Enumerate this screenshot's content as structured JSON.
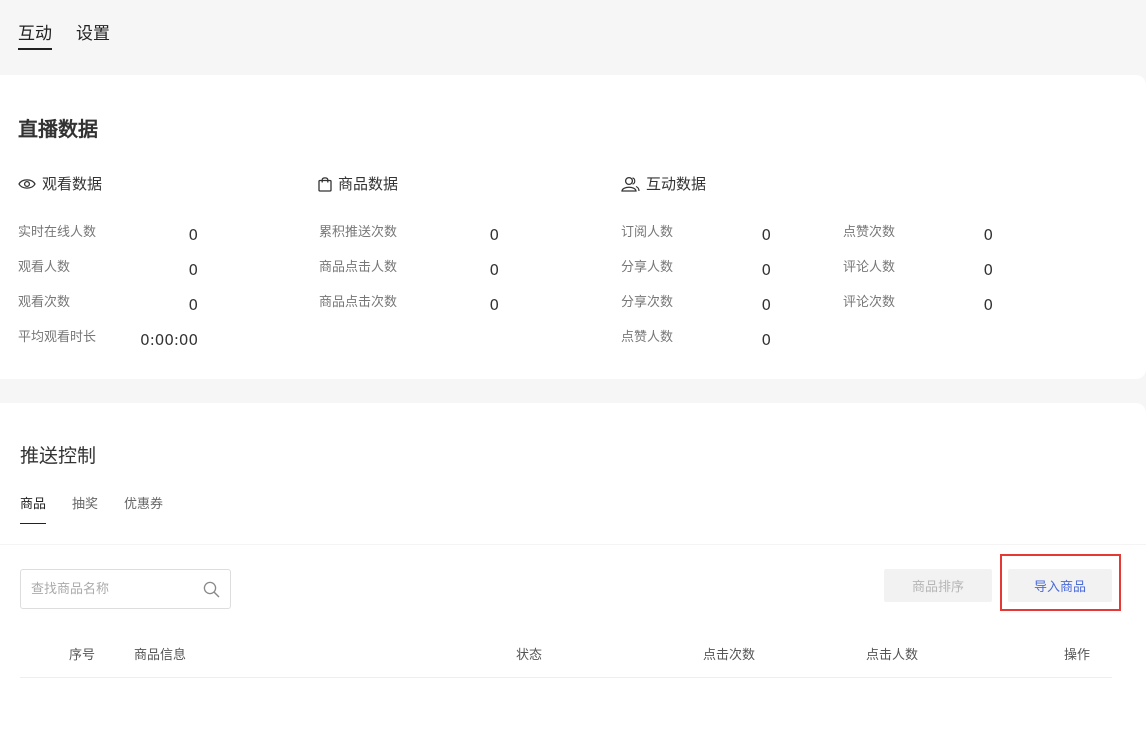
{
  "top_tabs": [
    {
      "label": "互动",
      "active": true
    },
    {
      "label": "设置",
      "active": false
    }
  ],
  "live_data": {
    "title": "直播数据",
    "groups": {
      "watch": {
        "title": "观看数据",
        "icon": "eye-icon",
        "stats": [
          {
            "label": "实时在线人数",
            "value": "0"
          },
          {
            "label": "观看人数",
            "value": "0"
          },
          {
            "label": "观看次数",
            "value": "0"
          },
          {
            "label": "平均观看时长",
            "value": "0:00:00"
          }
        ]
      },
      "product": {
        "title": "商品数据",
        "icon": "shopping-bag-icon",
        "stats": [
          {
            "label": "累积推送次数",
            "value": "0"
          },
          {
            "label": "商品点击人数",
            "value": "0"
          },
          {
            "label": "商品点击次数",
            "value": "0"
          }
        ]
      },
      "interaction": {
        "title": "互动数据",
        "icon": "users-icon",
        "stats_left": [
          {
            "label": "订阅人数",
            "value": "0"
          },
          {
            "label": "分享人数",
            "value": "0"
          },
          {
            "label": "分享次数",
            "value": "0"
          },
          {
            "label": "点赞人数",
            "value": "0"
          }
        ],
        "stats_right": [
          {
            "label": "点赞次数",
            "value": "0"
          },
          {
            "label": "评论人数",
            "value": "0"
          },
          {
            "label": "评论次数",
            "value": "0"
          }
        ]
      }
    }
  },
  "push_control": {
    "title": "推送控制",
    "tabs": [
      {
        "label": "商品",
        "active": true
      },
      {
        "label": "抽奖",
        "active": false
      },
      {
        "label": "优惠券",
        "active": false
      }
    ]
  },
  "product_list": {
    "search": {
      "value": "",
      "placeholder": "查找商品名称"
    },
    "sort_button": "商品排序",
    "import_button": "导入商品",
    "columns": [
      "序号",
      "商品信息",
      "状态",
      "点击次数",
      "点击人数",
      "操作"
    ]
  },
  "colors": {
    "accent": "#4a6ad8",
    "highlight": "#e53935",
    "background": "#f6f6f6"
  }
}
